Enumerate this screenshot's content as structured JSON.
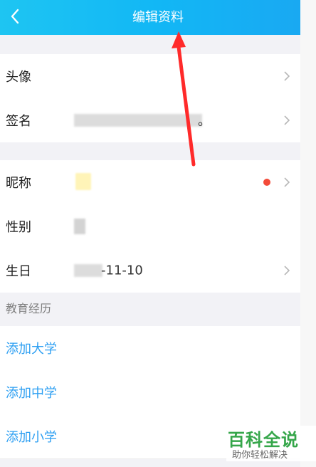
{
  "header": {
    "title": "编辑资料",
    "back_icon": "chevron-left-icon"
  },
  "rows": {
    "avatar": {
      "label": "头像"
    },
    "signature": {
      "label": "签名",
      "value": "。"
    },
    "nickname": {
      "label": "昵称"
    },
    "gender": {
      "label": "性别"
    },
    "birthday": {
      "label": "生日",
      "value": "-11-10"
    }
  },
  "education": {
    "section_title": "教育经历",
    "items": [
      {
        "label": "添加大学"
      },
      {
        "label": "添加中学"
      },
      {
        "label": "添加小学"
      }
    ]
  },
  "watermark": {
    "title": "百科全说",
    "subtitle": "助你轻松解决"
  },
  "colors": {
    "header_gradient_start": "#1ec5f2",
    "header_gradient_end": "#1aa7f2",
    "link_blue": "#2d9ff2",
    "badge_red": "#f34b39",
    "arrow_red": "#ff2a2a"
  }
}
